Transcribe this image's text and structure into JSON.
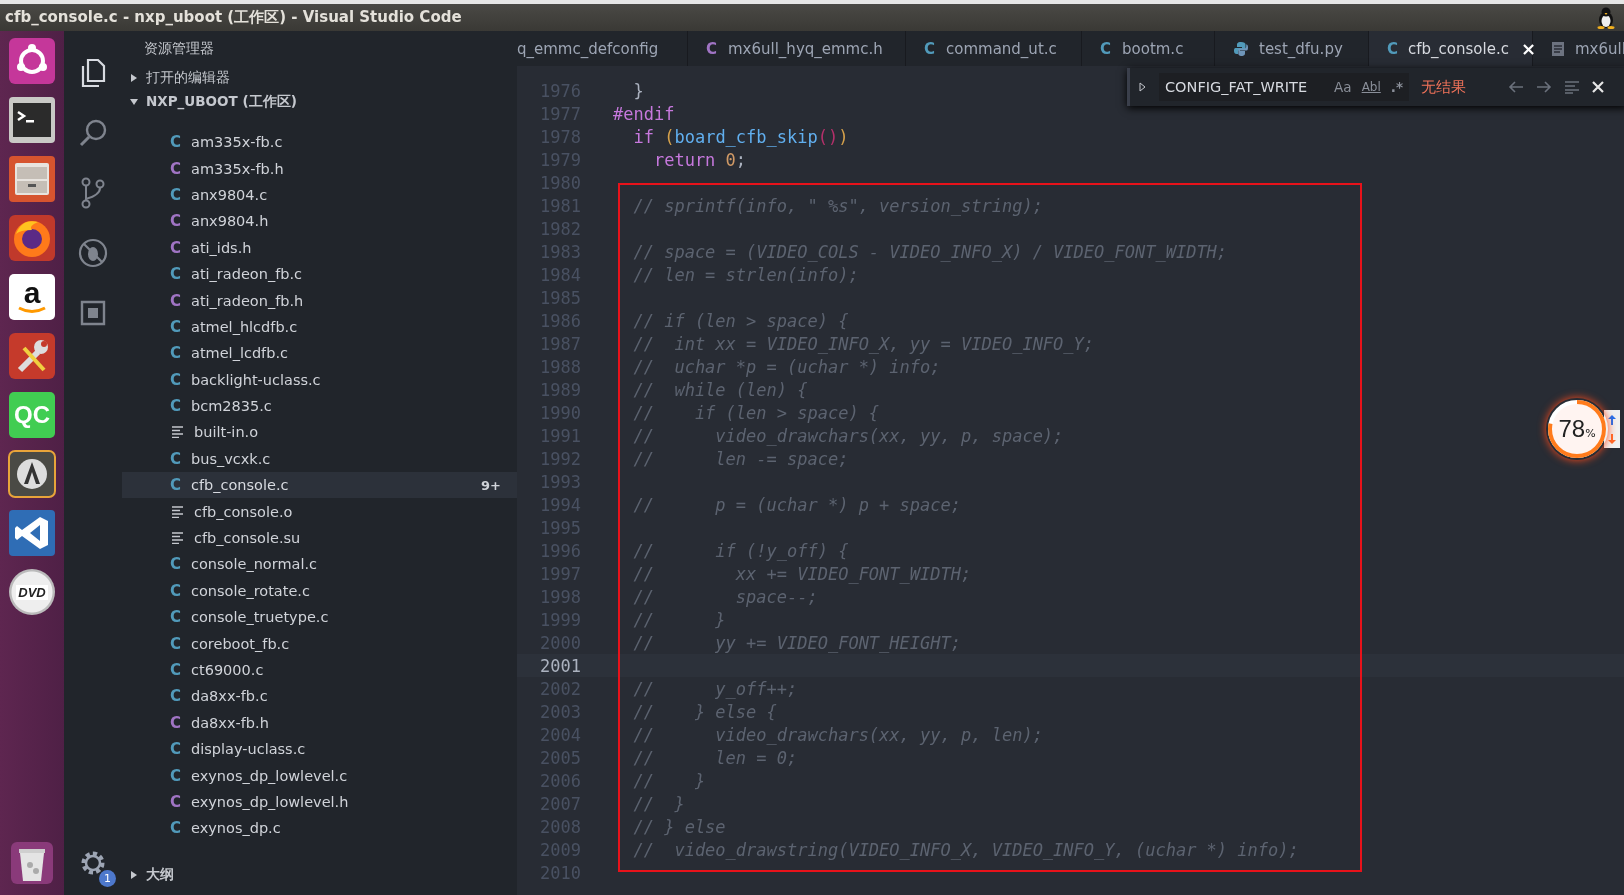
{
  "window": {
    "title": "cfb_console.c - nxp_uboot (工作区) - Visual Studio Code"
  },
  "launcher": [
    {
      "kind": "ubuntu"
    },
    {
      "kind": "terminal"
    },
    {
      "kind": "files"
    },
    {
      "kind": "firefox"
    },
    {
      "kind": "amazon",
      "label": "a"
    },
    {
      "kind": "tools"
    },
    {
      "kind": "qc",
      "label": "QC"
    },
    {
      "kind": "updater"
    },
    {
      "kind": "vscode"
    },
    {
      "kind": "dvd",
      "label": "DVD"
    },
    {
      "kind": "trash"
    }
  ],
  "activity_bar": {
    "items": [
      {
        "kind": "explorer",
        "selected": true
      },
      {
        "kind": "search",
        "selected": false
      },
      {
        "kind": "scm",
        "selected": false
      },
      {
        "kind": "debug",
        "selected": false
      },
      {
        "kind": "extensions",
        "selected": false
      }
    ],
    "settings_badge": "1"
  },
  "sidebar": {
    "title": "资源管理器",
    "open_editors": {
      "label": "打开的编辑器",
      "expanded": false
    },
    "workspace": {
      "label": "NXP_UBOOT (工作区)",
      "expanded": true
    },
    "files": [
      {
        "name": "am335x-fb.c",
        "kind": "c",
        "icon": "C",
        "selected": false
      },
      {
        "name": "am335x-fb.h",
        "kind": "h",
        "icon": "C",
        "selected": false
      },
      {
        "name": "anx9804.c",
        "kind": "c",
        "icon": "C",
        "selected": false
      },
      {
        "name": "anx9804.h",
        "kind": "h",
        "icon": "C",
        "selected": false
      },
      {
        "name": "ati_ids.h",
        "kind": "h",
        "icon": "C",
        "selected": false
      },
      {
        "name": "ati_radeon_fb.c",
        "kind": "c",
        "icon": "C",
        "selected": false
      },
      {
        "name": "ati_radeon_fb.h",
        "kind": "h",
        "icon": "C",
        "selected": false
      },
      {
        "name": "atmel_hlcdfb.c",
        "kind": "c",
        "icon": "C",
        "selected": false
      },
      {
        "name": "atmel_lcdfb.c",
        "kind": "c",
        "icon": "C",
        "selected": false
      },
      {
        "name": "backlight-uclass.c",
        "kind": "c",
        "icon": "C",
        "selected": false
      },
      {
        "name": "bcm2835.c",
        "kind": "c",
        "icon": "C",
        "selected": false
      },
      {
        "name": "built-in.o",
        "kind": "bin",
        "selected": false
      },
      {
        "name": "bus_vcxk.c",
        "kind": "c",
        "icon": "C",
        "selected": false
      },
      {
        "name": "cfb_console.c",
        "kind": "c",
        "icon": "C",
        "selected": true,
        "badge": "9+"
      },
      {
        "name": "cfb_console.o",
        "kind": "bin",
        "selected": false
      },
      {
        "name": "cfb_console.su",
        "kind": "bin",
        "selected": false
      },
      {
        "name": "console_normal.c",
        "kind": "c",
        "icon": "C",
        "selected": false
      },
      {
        "name": "console_rotate.c",
        "kind": "c",
        "icon": "C",
        "selected": false
      },
      {
        "name": "console_truetype.c",
        "kind": "c",
        "icon": "C",
        "selected": false
      },
      {
        "name": "coreboot_fb.c",
        "kind": "c",
        "icon": "C",
        "selected": false
      },
      {
        "name": "ct69000.c",
        "kind": "c",
        "icon": "C",
        "selected": false
      },
      {
        "name": "da8xx-fb.c",
        "kind": "c",
        "icon": "C",
        "selected": false
      },
      {
        "name": "da8xx-fb.h",
        "kind": "h",
        "icon": "C",
        "selected": false
      },
      {
        "name": "display-uclass.c",
        "kind": "c",
        "icon": "C",
        "selected": false
      },
      {
        "name": "exynos_dp_lowlevel.c",
        "kind": "c",
        "icon": "C",
        "selected": false
      },
      {
        "name": "exynos_dp_lowlevel.h",
        "kind": "h",
        "icon": "C",
        "selected": false
      },
      {
        "name": "exynos_dp.c",
        "kind": "c",
        "icon": "C",
        "selected": false
      }
    ],
    "outline": {
      "label": "大纲",
      "expanded": false
    }
  },
  "tabs": [
    {
      "label": "q_emmc_defconfig",
      "kind": "none",
      "selected": false
    },
    {
      "label": "mx6ull_hyq_emmc.h",
      "kind": "h",
      "icon": "C",
      "selected": false
    },
    {
      "label": "command_ut.c",
      "kind": "c",
      "icon": "C",
      "selected": false
    },
    {
      "label": "bootm.c",
      "kind": "c",
      "icon": "C",
      "selected": false
    },
    {
      "label": "test_dfu.py",
      "kind": "py",
      "selected": false
    },
    {
      "label": "cfb_console.c",
      "kind": "c",
      "icon": "C",
      "selected": true,
      "close": "×"
    },
    {
      "label": "mx6ull",
      "kind": "file",
      "selected": false
    }
  ],
  "find_widget": {
    "value": "CONFIG_FAT_WRITE",
    "options": [
      "Aa",
      "Abl",
      ".*"
    ],
    "result": "无结果"
  },
  "lines": [
    {
      "number": "1976",
      "tokens": [
        {
          "text": "  }",
          "kind": "plain"
        }
      ],
      "boxed": false,
      "current": false
    },
    {
      "number": "1977",
      "tokens": [
        {
          "text": "#endif",
          "kind": "keyword"
        }
      ],
      "boxed": false,
      "current": false
    },
    {
      "number": "1978",
      "tokens": [
        {
          "text": "  if ",
          "kind": "keyword"
        },
        {
          "text": "(",
          "kind": "paren"
        },
        {
          "text": "board_cfb_skip",
          "kind": "function"
        },
        {
          "text": "()",
          "kind": "inner_paren"
        },
        {
          "text": ")",
          "kind": "paren"
        }
      ],
      "boxed": false,
      "current": false
    },
    {
      "number": "1979",
      "tokens": [
        {
          "text": "    return ",
          "kind": "keyword"
        },
        {
          "text": "0",
          "kind": "number"
        },
        {
          "text": ";",
          "kind": "plain"
        }
      ],
      "boxed": false,
      "current": false
    },
    {
      "number": "1980",
      "boxed": false,
      "current": false
    },
    {
      "number": "1981",
      "tokens": [
        {
          "text": "  // sprintf(info, \" %s\", version_string);",
          "kind": "comment"
        }
      ],
      "boxed": true,
      "current": false
    },
    {
      "number": "1982",
      "boxed": true,
      "current": false
    },
    {
      "number": "1983",
      "tokens": [
        {
          "text": "  // space = (VIDEO_COLS - VIDEO_INFO_X) / VIDEO_FONT_WIDTH;",
          "kind": "comment"
        }
      ],
      "boxed": true,
      "current": false
    },
    {
      "number": "1984",
      "tokens": [
        {
          "text": "  // len = strlen(info);",
          "kind": "comment"
        }
      ],
      "boxed": true,
      "current": false
    },
    {
      "number": "1985",
      "boxed": true,
      "current": false
    },
    {
      "number": "1986",
      "tokens": [
        {
          "text": "  // if (len > space) {",
          "kind": "comment"
        }
      ],
      "boxed": true,
      "current": false
    },
    {
      "number": "1987",
      "tokens": [
        {
          "text": "  //  int xx = VIDEO_INFO_X, yy = VIDEO_INFO_Y;",
          "kind": "comment"
        }
      ],
      "boxed": true,
      "current": false
    },
    {
      "number": "1988",
      "tokens": [
        {
          "text": "  //  uchar *p = (uchar *) info;",
          "kind": "comment"
        }
      ],
      "boxed": true,
      "current": false
    },
    {
      "number": "1989",
      "tokens": [
        {
          "text": "  //  while (len) {",
          "kind": "comment"
        }
      ],
      "boxed": true,
      "current": false
    },
    {
      "number": "1990",
      "tokens": [
        {
          "text": "  //    if (len > space) {",
          "kind": "comment"
        }
      ],
      "boxed": true,
      "current": false
    },
    {
      "number": "1991",
      "tokens": [
        {
          "text": "  //      video_drawchars(xx, yy, p, space);",
          "kind": "comment"
        }
      ],
      "boxed": true,
      "current": false
    },
    {
      "number": "1992",
      "tokens": [
        {
          "text": "  //      len -= space;",
          "kind": "comment"
        }
      ],
      "boxed": true,
      "current": false
    },
    {
      "number": "1993",
      "boxed": true,
      "current": false
    },
    {
      "number": "1994",
      "tokens": [
        {
          "text": "  //      p = (uchar *) p + space;",
          "kind": "comment"
        }
      ],
      "boxed": true,
      "current": false
    },
    {
      "number": "1995",
      "boxed": true,
      "current": false
    },
    {
      "number": "1996",
      "tokens": [
        {
          "text": "  //      if (!y_off) {",
          "kind": "comment"
        }
      ],
      "boxed": true,
      "current": false
    },
    {
      "number": "1997",
      "tokens": [
        {
          "text": "  //        xx += VIDEO_FONT_WIDTH;",
          "kind": "comment"
        }
      ],
      "boxed": true,
      "current": false
    },
    {
      "number": "1998",
      "tokens": [
        {
          "text": "  //        space--;",
          "kind": "comment"
        }
      ],
      "boxed": true,
      "current": false
    },
    {
      "number": "1999",
      "tokens": [
        {
          "text": "  //      }",
          "kind": "comment"
        }
      ],
      "boxed": true,
      "current": false
    },
    {
      "number": "2000",
      "tokens": [
        {
          "text": "  //      yy += VIDEO_FONT_HEIGHT;",
          "kind": "comment"
        }
      ],
      "boxed": true,
      "current": false
    },
    {
      "number": "2001",
      "boxed": true,
      "current": true
    },
    {
      "number": "2002",
      "tokens": [
        {
          "text": "  //      y_off++;",
          "kind": "comment"
        }
      ],
      "boxed": true,
      "current": false
    },
    {
      "number": "2003",
      "tokens": [
        {
          "text": "  //    } else {",
          "kind": "comment"
        }
      ],
      "boxed": true,
      "current": false
    },
    {
      "number": "2004",
      "tokens": [
        {
          "text": "  //      video_drawchars(xx, yy, p, len);",
          "kind": "comment"
        }
      ],
      "boxed": true,
      "current": false
    },
    {
      "number": "2005",
      "tokens": [
        {
          "text": "  //      len = 0;",
          "kind": "comment"
        }
      ],
      "boxed": true,
      "current": false
    },
    {
      "number": "2006",
      "tokens": [
        {
          "text": "  //    }",
          "kind": "comment"
        }
      ],
      "boxed": true,
      "current": false
    },
    {
      "number": "2007",
      "tokens": [
        {
          "text": "  //  }",
          "kind": "comment"
        }
      ],
      "boxed": true,
      "current": false
    },
    {
      "number": "2008",
      "tokens": [
        {
          "text": "  // } else",
          "kind": "comment"
        }
      ],
      "boxed": true,
      "current": false
    },
    {
      "number": "2009",
      "tokens": [
        {
          "text": "  //  video_drawstring(VIDEO_INFO_X, VIDEO_INFO_Y, (uchar *) info);",
          "kind": "comment"
        }
      ],
      "boxed": true,
      "current": false
    },
    {
      "number": "2010",
      "boxed": false,
      "current": false
    }
  ],
  "speed_ball": {
    "value": "78",
    "unit": "%",
    "level": 0.78
  }
}
